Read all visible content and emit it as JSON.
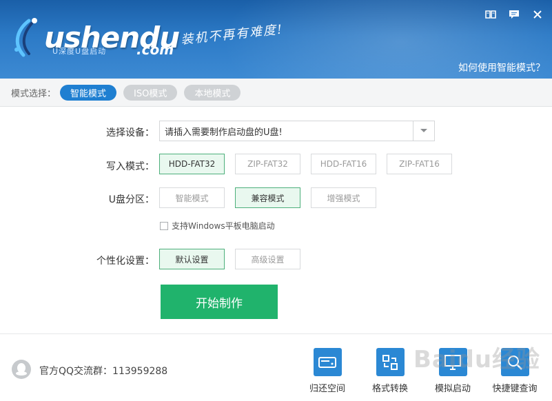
{
  "header": {
    "logo_main": "ushendu",
    "logo_sub": "U深度U盘启动",
    "logo_com": ".com",
    "slogan": "装机不再有难度!",
    "help_link": "如何使用智能模式？"
  },
  "mode_bar": {
    "label": "模式选择：",
    "modes": [
      {
        "label": "智能模式",
        "active": true
      },
      {
        "label": "ISO模式",
        "active": false
      },
      {
        "label": "本地模式",
        "active": false
      }
    ]
  },
  "form": {
    "device_label": "选择设备：",
    "device_placeholder": "请插入需要制作启动盘的U盘!",
    "write_label": "写入模式：",
    "write_options": [
      {
        "label": "HDD-FAT32",
        "selected": true
      },
      {
        "label": "ZIP-FAT32",
        "selected": false
      },
      {
        "label": "HDD-FAT16",
        "selected": false
      },
      {
        "label": "ZIP-FAT16",
        "selected": false
      }
    ],
    "partition_label": "U盘分区：",
    "partition_options": [
      {
        "label": "智能模式",
        "selected": false
      },
      {
        "label": "兼容模式",
        "selected": true
      },
      {
        "label": "增强模式",
        "selected": false
      }
    ],
    "checkbox_label": "支持Windows平板电脑启动",
    "checkbox_checked": false,
    "personal_label": "个性化设置：",
    "personal_options": [
      {
        "label": "默认设置",
        "selected": true
      },
      {
        "label": "高级设置",
        "selected": false
      }
    ],
    "start_button": "开始制作"
  },
  "footer": {
    "qq_text": "官方QQ交流群：113959288",
    "tools": [
      {
        "label": "归还空间",
        "icon": "hdd-icon"
      },
      {
        "label": "格式转换",
        "icon": "convert-icon"
      },
      {
        "label": "模拟启动",
        "icon": "monitor-icon"
      },
      {
        "label": "快捷键查询",
        "icon": "search-key-icon"
      }
    ],
    "watermark": "Baidu经验"
  },
  "colors": {
    "header_blue": "#2c7ac6",
    "active_mode": "#1f7fd1",
    "start_green": "#20b36c",
    "selected_option_bg": "#e9f8ef",
    "tool_tile": "#2b88d4"
  }
}
